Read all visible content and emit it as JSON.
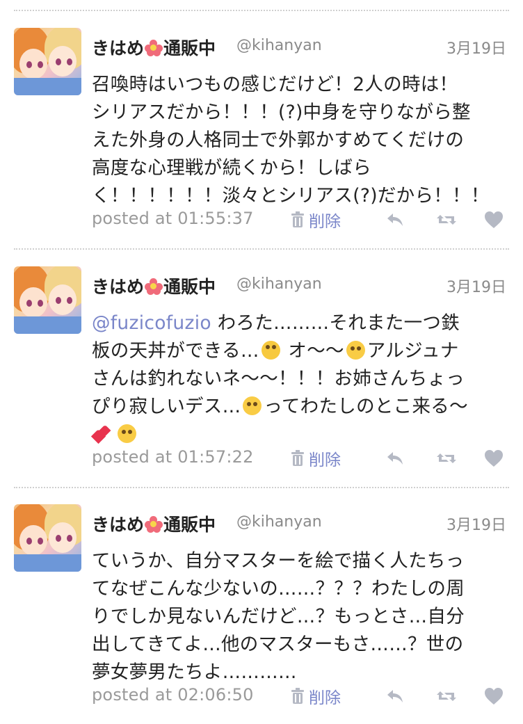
{
  "tweets": [
    {
      "name": "きはめ",
      "name_suffix": "通販中",
      "handle": "@kihanyan",
      "date": "3月19日",
      "lines": [
        "召喚時はいつもの感じだけど！2人の時は！",
        "シリアスだから！！！(?)中身を守りながら整",
        "えた外身の人格同士で外郭かすめてくだけの",
        "高度な心理戦が続くから！しばら",
        "く！！！！！！淡々とシリアス(?)だから！！！"
      ],
      "posted": "posted at 01:55:37",
      "delete_label": "削除"
    },
    {
      "name": "きはめ",
      "name_suffix": "通販中",
      "handle": "@kihanyan",
      "date": "3月19日",
      "mention": "@fuzicofuzio",
      "line1_rest": " わろた………それまた一つ鉄",
      "line2_a": "板の天丼ができる…",
      "line2_b": " オ〜〜",
      "line2_c": "アルジュナ",
      "line3": "さんは釣れないネ〜〜！！！お姉さんちょっ",
      "line4_a": "ぴり寂しいデス…",
      "line4_b": "ってわたしのとこ来る〜",
      "posted": "posted at 01:57:22",
      "delete_label": "削除"
    },
    {
      "name": "きはめ",
      "name_suffix": "通販中",
      "handle": "@kihanyan",
      "date": "3月19日",
      "lines": [
        "ていうか、自分マスターを絵で描く人たちっ",
        "てなぜこんな少ないの……？？？わたしの周",
        "りでしか見ないんだけど…？もっとさ…自分",
        "出してきてよ…他のマスターもさ……？世の",
        "夢女夢男たちよ…………"
      ],
      "posted": "posted at 02:06:50",
      "delete_label": "削除"
    }
  ],
  "icons": {
    "avatar": "anime-girls-avatar",
    "name_emoji": "hibiscus-icon",
    "delete": "trash-icon",
    "reply": "reply-icon",
    "retweet": "retweet-icon",
    "like": "heart-icon"
  },
  "colors": {
    "link": "#7a86c9",
    "meta": "#9a9a9a",
    "action_icon": "#b5b9c4",
    "divider": "#cfcfcf"
  }
}
